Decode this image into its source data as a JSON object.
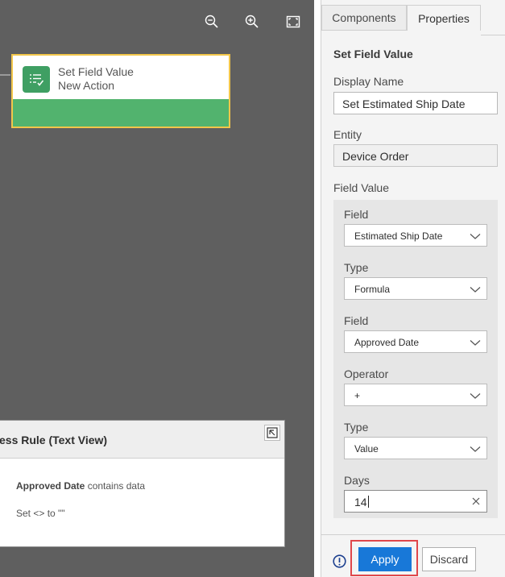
{
  "canvas": {
    "toolbar": [
      {
        "icon": "zoom-out-icon"
      },
      {
        "icon": "zoom-in-icon"
      },
      {
        "icon": "fit-to-screen-icon"
      }
    ],
    "node": {
      "title": "Set Field Value",
      "subtitle": "New Action",
      "icon": "set-field-value-icon",
      "border_color": "#f2c64a",
      "accent_color": "#52b36e"
    },
    "rule_panel": {
      "title": "ess Rule (Text View)",
      "line1_bold": "Approved Date",
      "line1_rest": " contains data",
      "line2": "Set <> to \"\""
    }
  },
  "properties_panel": {
    "tabs": [
      {
        "label": "Components",
        "active": false
      },
      {
        "label": "Properties",
        "active": true
      }
    ],
    "section_title": "Set Field Value",
    "display_name": {
      "label": "Display Name",
      "value": "Set Estimated Ship Date"
    },
    "entity": {
      "label": "Entity",
      "value": "Device Order"
    },
    "field_value": {
      "label": "Field Value",
      "field": {
        "label": "Field",
        "value": "Estimated Ship Date"
      },
      "type": {
        "label": "Type",
        "value": "Formula"
      },
      "field2": {
        "label": "Field",
        "value": "Approved Date"
      },
      "operator": {
        "label": "Operator",
        "value": "+"
      },
      "type2": {
        "label": "Type",
        "value": "Value"
      },
      "days": {
        "label": "Days",
        "value": "14"
      }
    },
    "footer": {
      "apply_label": "Apply",
      "discard_label": "Discard",
      "apply_color": "#1878d8",
      "highlight_color": "#e0474b"
    }
  }
}
